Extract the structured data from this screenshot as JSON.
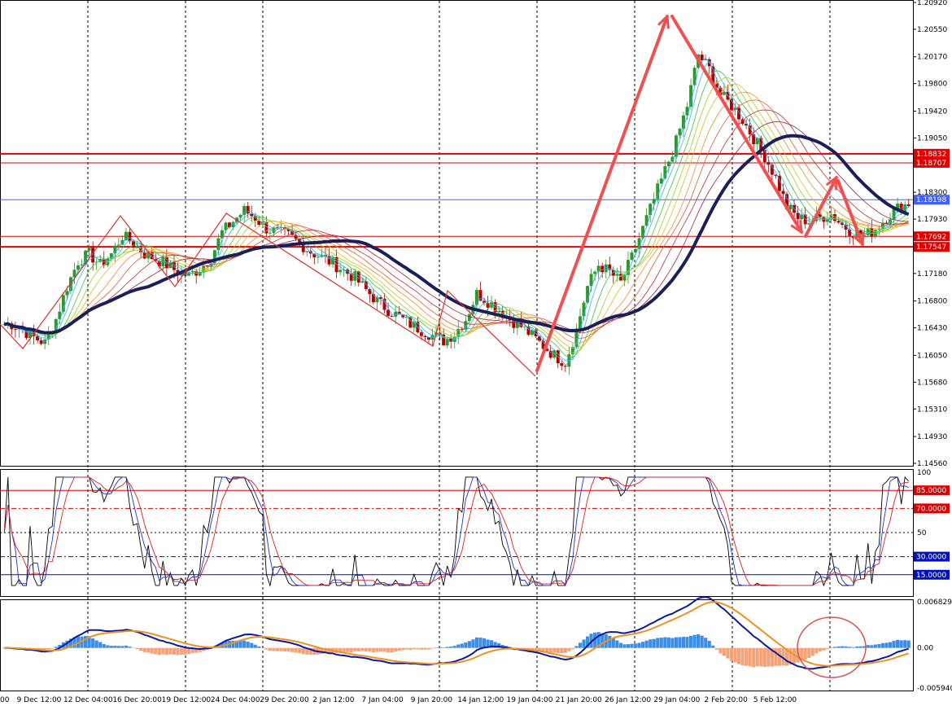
{
  "chart_data": [
    {
      "type": "candlestick",
      "panel": "price",
      "y_axis_labels": [
        "1.20920",
        "1.20550",
        "1.20170",
        "1.19800",
        "1.19420",
        "1.19050",
        "1.18707",
        "1.18300",
        "1.17930",
        "1.17547",
        "1.17180",
        "1.16800",
        "1.16430",
        "1.16050",
        "1.15680",
        "1.15310",
        "1.14930",
        "1.14560"
      ],
      "ylim": [
        1.1456,
        1.2092
      ],
      "x_axis_labels": [
        "00",
        "9 Dec 12:00",
        "12 Dec 04:00",
        "16 Dec 20:00",
        "19 Dec 12:00",
        "24 Dec 04:00",
        "29 Dec 20:00",
        "2 Jan 12:00",
        "7 Jan 04:00",
        "9 Jan 20:00",
        "14 Jan 12:00",
        "19 Jan 04:00",
        "21 Jan 20:00",
        "26 Jan 12:00",
        "29 Jan 04:00",
        "2 Feb 20:00",
        "5 Feb 12:00"
      ],
      "horizontal_levels": [
        {
          "value": 1.18832,
          "label": "1.18832",
          "color": "#e00000"
        },
        {
          "value": 1.18707,
          "label": "1.18707",
          "color": "#e00000"
        },
        {
          "value": 1.18198,
          "label": "1.18198",
          "color": "#4060ff"
        },
        {
          "value": 1.17692,
          "label": "1.17692",
          "color": "#e00000"
        },
        {
          "value": 1.17547,
          "label": "1.17547",
          "color": "#e00000"
        }
      ],
      "close_series": [
        1.1648,
        1.164,
        1.163,
        1.1622,
        1.1655,
        1.17,
        1.1735,
        1.1745,
        1.173,
        1.1745,
        1.177,
        1.176,
        1.1745,
        1.1738,
        1.173,
        1.172,
        1.1715,
        1.1725,
        1.174,
        1.1775,
        1.179,
        1.1805,
        1.1795,
        1.178,
        1.1775,
        1.177,
        1.176,
        1.1748,
        1.174,
        1.1732,
        1.1722,
        1.1712,
        1.1695,
        1.168,
        1.1668,
        1.1658,
        1.1648,
        1.164,
        1.1633,
        1.1625,
        1.1635,
        1.1655,
        1.169,
        1.168,
        1.1668,
        1.1655,
        1.1645,
        1.1632,
        1.1618,
        1.1605,
        1.1595,
        1.164,
        1.17,
        1.173,
        1.172,
        1.1705,
        1.174,
        1.178,
        1.182,
        1.186,
        1.19,
        1.195,
        1.202,
        1.2,
        1.1965,
        1.195,
        1.193,
        1.1905,
        1.188,
        1.185,
        1.181,
        1.1795,
        1.179,
        1.1795,
        1.18,
        1.1785,
        1.1775,
        1.177,
        1.178,
        1.1795,
        1.1808,
        1.1815
      ]
    },
    {
      "type": "line",
      "panel": "stochastic",
      "ylim": [
        0,
        100
      ],
      "y_axis_labels": [
        "100",
        "85.0000",
        "70.0000",
        "50",
        "30.0000",
        "15.0000"
      ],
      "levels": [
        85,
        70,
        50,
        30,
        15
      ]
    },
    {
      "type": "bar",
      "panel": "macd",
      "y_axis_labels": [
        "0.0068298",
        "0.00",
        "-0.005940"
      ],
      "ylim": [
        -0.00594,
        0.0068298
      ]
    }
  ],
  "colors": {
    "grid": "#000000",
    "level_red": "#e00000",
    "level_blue": "#4060ff",
    "arrow": "#f05050",
    "ma_heavy": "#1a1f5a",
    "up": "#2a9a2a",
    "down": "#b00000",
    "hist_pos": "#3a8ee8",
    "hist_neg": "#f4a27a",
    "macd_line": "#0a1aa0",
    "signal_line": "#f09020",
    "stoch_k": "#000000",
    "stoch_d": "#2030d0",
    "stoch_s": "#e02020"
  }
}
